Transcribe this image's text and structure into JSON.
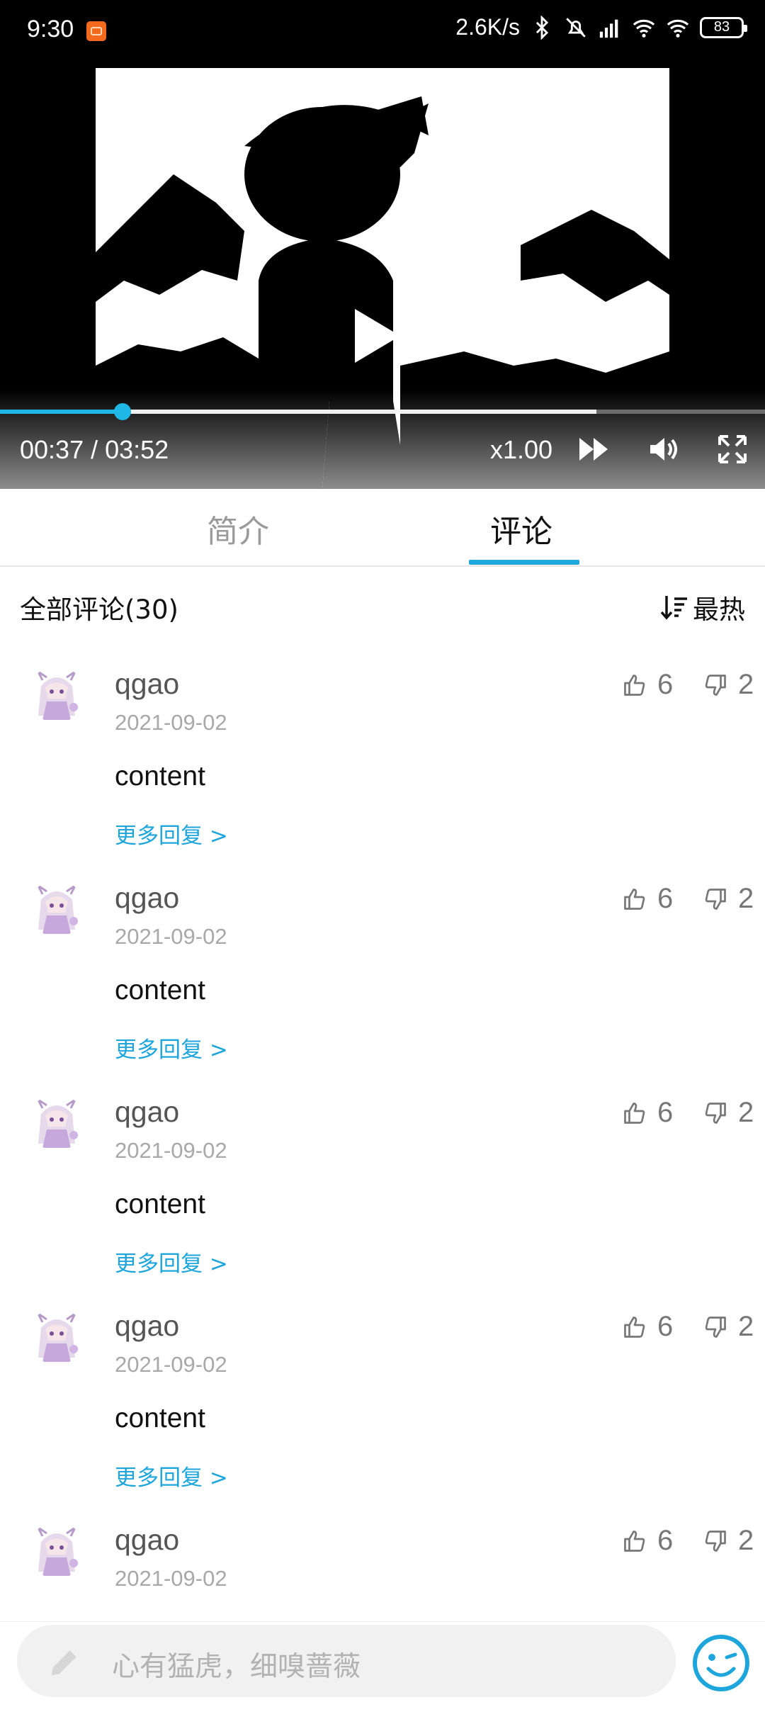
{
  "status_bar": {
    "time": "9:30",
    "net_speed": "2.6K/s",
    "battery": "83",
    "icons": [
      "app-notification-icon",
      "bluetooth-icon",
      "mute-icon",
      "cell-signal-icon",
      "wifi-icon",
      "wifi-icon-2",
      "battery-icon"
    ]
  },
  "player": {
    "current_time": "00:37",
    "separator": " / ",
    "duration": "03:52",
    "speed": "x1.00",
    "progress_fraction": 0.16,
    "buffered_fraction": 0.78,
    "accent_color": "#1fb7e6"
  },
  "tabs": [
    {
      "label": "简介",
      "active": false
    },
    {
      "label": "评论",
      "active": true
    }
  ],
  "comments_header": {
    "count_label": "全部评论(30)",
    "sort_label": "最热"
  },
  "comments": [
    {
      "user": "qgao",
      "date": "2021-09-02",
      "text": "content",
      "more": "更多回复 >",
      "likes": "6",
      "dislikes": "2"
    },
    {
      "user": "qgao",
      "date": "2021-09-02",
      "text": "content",
      "more": "更多回复 >",
      "likes": "6",
      "dislikes": "2"
    },
    {
      "user": "qgao",
      "date": "2021-09-02",
      "text": "content",
      "more": "更多回复 >",
      "likes": "6",
      "dislikes": "2"
    },
    {
      "user": "qgao",
      "date": "2021-09-02",
      "text": "content",
      "more": "更多回复 >",
      "likes": "6",
      "dislikes": "2"
    },
    {
      "user": "qgao",
      "date": "2021-09-02",
      "text": "",
      "more": "",
      "likes": "6",
      "dislikes": "2"
    }
  ],
  "composer": {
    "placeholder": "心有猛虎，细嗅蔷薇"
  }
}
